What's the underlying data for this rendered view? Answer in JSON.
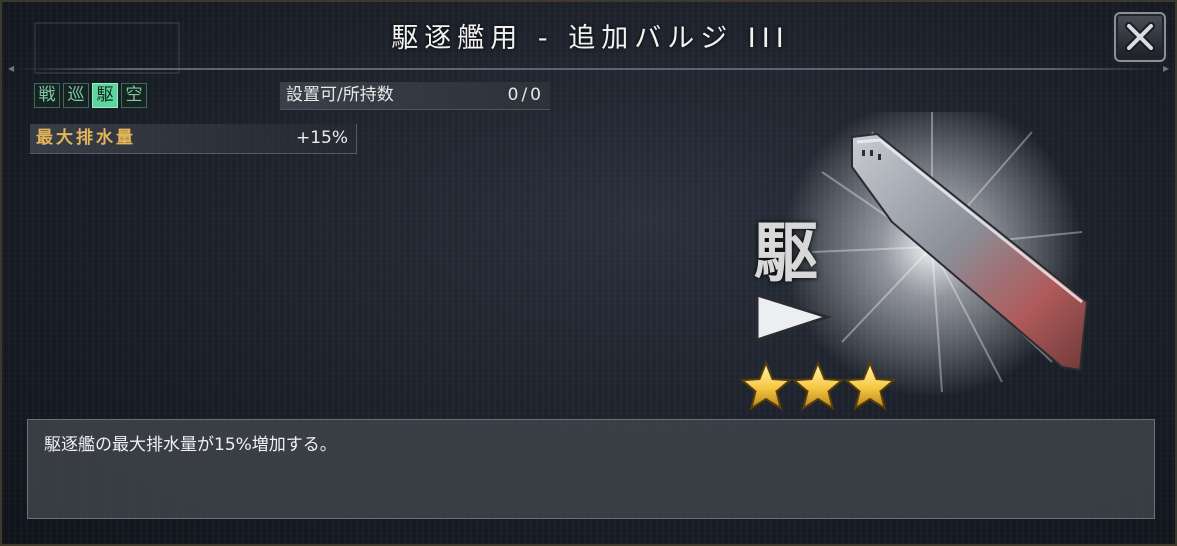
{
  "dialog": {
    "title": "駆逐艦用 - 追加バルジ III",
    "close_icon": "close-icon"
  },
  "ship_types": [
    {
      "label": "戦",
      "active": false
    },
    {
      "label": "巡",
      "active": false
    },
    {
      "label": "駆",
      "active": true
    },
    {
      "label": "空",
      "active": false
    }
  ],
  "slot": {
    "label": "設置可/所持数",
    "value": "0/0"
  },
  "stat": {
    "label": "最大排水量",
    "value": "+15%"
  },
  "item_card": {
    "type_kanji": "駆",
    "rarity_stars": 3,
    "icon": "hull-bulge-icon"
  },
  "description": "駆逐艦の最大排水量が15%増加する。",
  "colors": {
    "active_type": "#5fd3a0",
    "stat_label": "#e3b45a",
    "star": "#f5c843"
  }
}
